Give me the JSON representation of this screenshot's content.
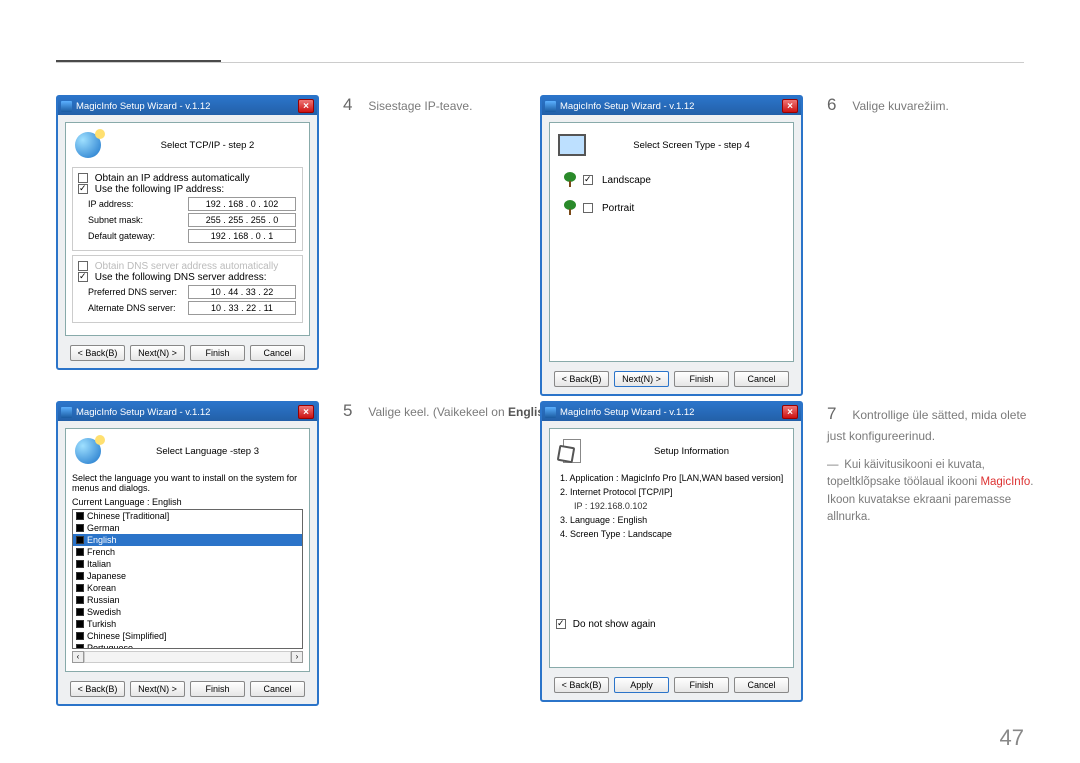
{
  "page_number": "47",
  "window_title": "MagicInfo Setup Wizard - v.1.12",
  "buttons": {
    "back": "< Back(B)",
    "next": "Next(N) >",
    "finish": "Finish",
    "cancel": "Cancel",
    "apply": "Apply"
  },
  "step4": {
    "caption_num": "4",
    "caption": "Sisestage IP-teave.",
    "title": "Select TCP/IP - step 2",
    "obtain_auto": "Obtain an IP address automatically",
    "use_following": "Use the following IP address:",
    "ip_label": "IP address:",
    "ip_value": "192 . 168 .  0  . 102",
    "subnet_label": "Subnet mask:",
    "subnet_value": "255 . 255 . 255 .  0",
    "gateway_label": "Default gateway:",
    "gateway_value": "192 . 168 .  0  .   1",
    "obtain_dns_auto": "Obtain DNS server address automatically",
    "use_following_dns": "Use the following DNS server address:",
    "pref_dns_label": "Preferred DNS server:",
    "pref_dns_value": "10 . 44 . 33 . 22",
    "alt_dns_label": "Alternate DNS server:",
    "alt_dns_value": "10 . 33 . 22 . 11"
  },
  "step5": {
    "caption_num": "5",
    "caption_pre": "Valige keel. (Vaikekeel on ",
    "caption_bold": "English",
    "caption_post": ".)",
    "title": "Select Language -step 3",
    "prompt": "Select the language you want to install on the system for menus and dialogs.",
    "current_label": "Current Language    :   English",
    "items": [
      "Chinese [Traditional]",
      "German",
      "English",
      "French",
      "Italian",
      "Japanese",
      "Korean",
      "Russian",
      "Swedish",
      "Turkish",
      "Chinese [Simplified]",
      "Portuguese"
    ],
    "selected": "English"
  },
  "step6": {
    "caption_num": "6",
    "caption": "Valige kuvarežiim.",
    "title": "Select Screen Type - step 4",
    "landscape": "Landscape",
    "portrait": "Portrait"
  },
  "step7": {
    "caption_num": "7",
    "caption": "Kontrollige üle sätted, mida olete just konfigureerinud.",
    "title": "Setup Information",
    "app_line": "1. Application    :    MagicInfo Pro [LAN,WAN based version]",
    "ip_line": "2. Internet Protocol [TCP/IP]",
    "ip_sub": "IP  :    192.168.0.102",
    "lang_line": "3. Language  :    English",
    "screen_line": "4. Screen Type :    Landscape",
    "dont_show": "Do not show again"
  },
  "note": {
    "dash": "―",
    "line1": "Kui käivitusikooni ei kuvata, topeltklõpsake töölaual ikooni ",
    "bold": "MagicInfo",
    "line2": ". Ikoon kuvatakse ekraani paremasse allnurka."
  }
}
